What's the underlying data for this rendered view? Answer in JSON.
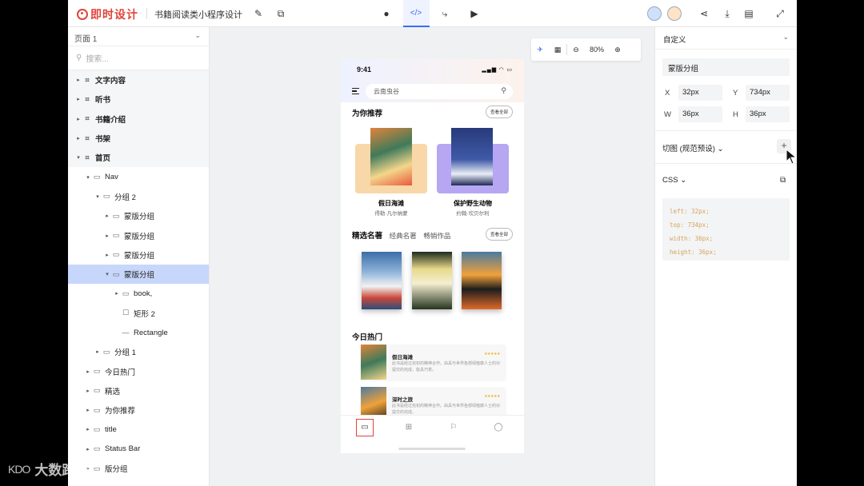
{
  "topbar": {
    "logo_text": "即时设计",
    "project_title": "书籍阅读类小程序设计",
    "zoom": "80%"
  },
  "left_panel": {
    "page_select": "页面 1",
    "search_placeholder": "搜索...",
    "layers": [
      {
        "label": "文字内容",
        "depth": 0,
        "kind": "frame",
        "arrow": "right",
        "top": true
      },
      {
        "label": "听书",
        "depth": 0,
        "kind": "frame",
        "arrow": "right",
        "top": true
      },
      {
        "label": "书籍介绍",
        "depth": 0,
        "kind": "frame",
        "arrow": "right",
        "top": true
      },
      {
        "label": "书架",
        "depth": 0,
        "kind": "frame",
        "arrow": "right",
        "top": true
      },
      {
        "label": "首页",
        "depth": 0,
        "kind": "frame",
        "arrow": "down",
        "top": true
      },
      {
        "label": "Nav",
        "depth": 1,
        "kind": "folder",
        "arrow": "down"
      },
      {
        "label": "分组 2",
        "depth": 2,
        "kind": "folder",
        "arrow": "down"
      },
      {
        "label": "蒙版分组",
        "depth": 3,
        "kind": "folder",
        "arrow": "right"
      },
      {
        "label": "蒙版分组",
        "depth": 3,
        "kind": "folder",
        "arrow": "right"
      },
      {
        "label": "蒙版分组",
        "depth": 3,
        "kind": "folder",
        "arrow": "right"
      },
      {
        "label": "蒙版分组",
        "depth": 3,
        "kind": "folder",
        "arrow": "down",
        "selected": true
      },
      {
        "label": "book,",
        "depth": 4,
        "kind": "folder",
        "arrow": "right"
      },
      {
        "label": "矩形 2",
        "depth": 4,
        "kind": "rect",
        "arrow": ""
      },
      {
        "label": "Rectangle",
        "depth": 4,
        "kind": "line",
        "arrow": ""
      },
      {
        "label": "分组 1",
        "depth": 2,
        "kind": "folder",
        "arrow": "right"
      },
      {
        "label": "今日热门",
        "depth": 1,
        "kind": "folder",
        "arrow": "right"
      },
      {
        "label": "精选",
        "depth": 1,
        "kind": "folder",
        "arrow": "right"
      },
      {
        "label": "为你推荐",
        "depth": 1,
        "kind": "folder",
        "arrow": "right"
      },
      {
        "label": "title",
        "depth": 1,
        "kind": "folder",
        "arrow": "right"
      },
      {
        "label": "Status Bar",
        "depth": 1,
        "kind": "folder",
        "arrow": "right"
      },
      {
        "label": "版分组",
        "depth": 1,
        "kind": "folder",
        "arrow": "right"
      }
    ]
  },
  "phone": {
    "time": "9:41",
    "search_text": "云南虫谷",
    "section_recommend": "为你推荐",
    "view_all": "查看全部",
    "rec_books": [
      {
        "title": "假日海滩",
        "author": "得勒·凡尔纳蒙",
        "card_color": "#f8d7a8"
      },
      {
        "title": "保护野生动物",
        "author": "约翰·坎贝尔利",
        "card_color": "#b7a6f2"
      }
    ],
    "section_classics": "精选名著",
    "tab_classic": "经典名著",
    "tab_bestseller": "畅销作品",
    "view_all_2": "查看全部",
    "section_hot": "今日热门",
    "hot_items": [
      {
        "title": "假日海滩",
        "desc": "此书是经过完初的精神合作。由具与世界各部绿植康人士的对提交的完成，能具巧意。"
      },
      {
        "title": "深时之旅",
        "desc": "此书是经过完初的精神合作。由具与世界各部绿植康人士的对提交的完成。"
      }
    ]
  },
  "right_panel": {
    "mode": "自定义",
    "layer_name": "蒙版分组",
    "x_label": "X",
    "x_value": "32px",
    "y_label": "Y",
    "y_value": "734px",
    "w_label": "W",
    "w_value": "36px",
    "h_label": "H",
    "h_value": "36px",
    "slice_label": "切图 (规范预设)",
    "css_label": "CSS",
    "css_lines": [
      "left: 32px;",
      "top: 734px;",
      "width: 36px;",
      "height: 36px;"
    ]
  },
  "watermark": {
    "mark": "KDO",
    "text": "大数跨境"
  },
  "colors": {
    "accent": "#3b6cf6",
    "brand": "#e0443a",
    "selection": "#c7d6fb",
    "css_code": "#d6a55a"
  }
}
